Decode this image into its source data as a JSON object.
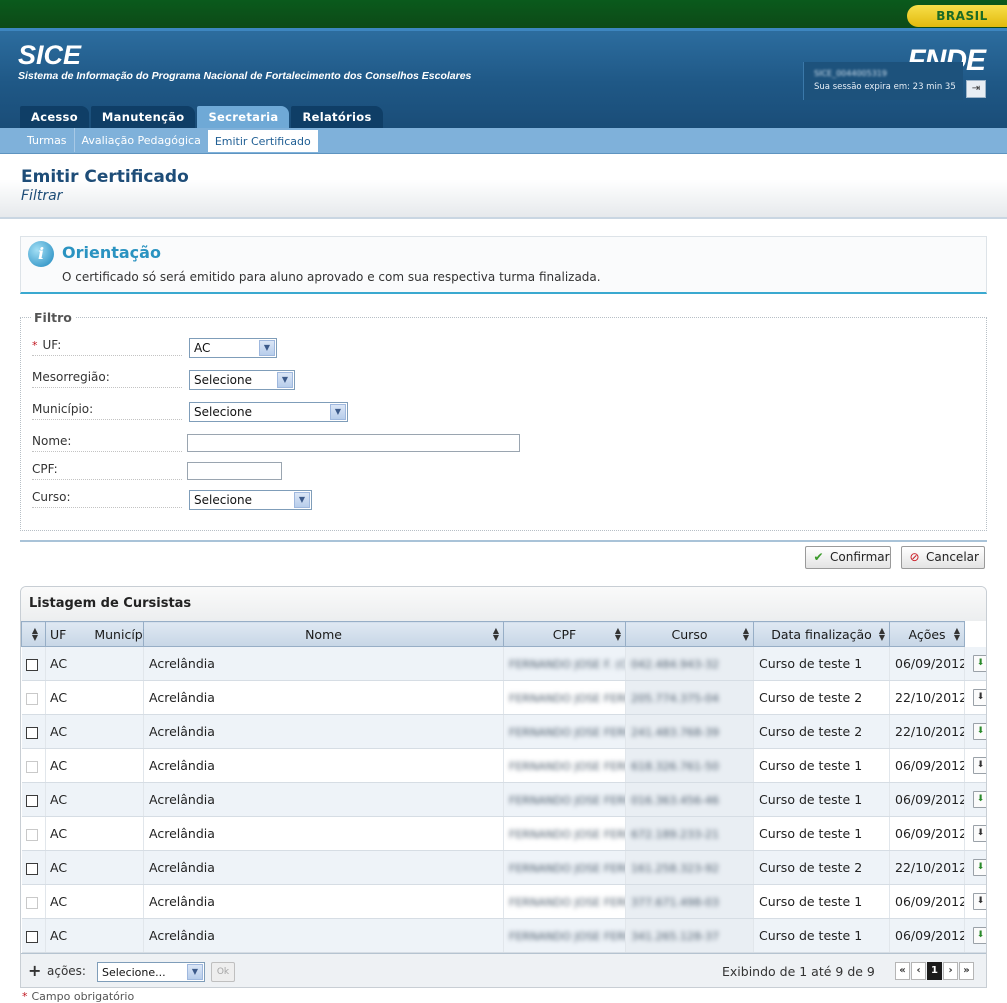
{
  "govbar": {
    "brasil": "BRASIL"
  },
  "header": {
    "title": "SICE",
    "subtitle": "Sistema de Informação do Programa Nacional de Fortalecimento dos Conselhos Escolares",
    "logo": "FNDE",
    "session_user": "SICE_0044005319",
    "session_expire": "Sua sessão expira em: 23 min 35"
  },
  "tabs": [
    {
      "label": "Acesso"
    },
    {
      "label": "Manutenção"
    },
    {
      "label": "Secretaria"
    },
    {
      "label": "Relatórios"
    }
  ],
  "subtabs": [
    {
      "label": "Turmas"
    },
    {
      "label": "Avaliação Pedagógica"
    },
    {
      "label": "Emitir Certificado"
    }
  ],
  "page": {
    "title": "Emitir Certificado",
    "subtitle": "Filtrar"
  },
  "orientation": {
    "title": "Orientação",
    "text": "O certificado só será emitido para aluno aprovado e com sua respectiva turma finalizada."
  },
  "filter": {
    "legend": "Filtro",
    "uf_label": "UF:",
    "uf_value": "AC",
    "mesorregiao_label": "Mesorregião:",
    "mesorregiao_value": "Selecione",
    "municipio_label": "Município:",
    "municipio_value": "Selecione",
    "nome_label": "Nome:",
    "nome_value": "",
    "cpf_label": "CPF:",
    "cpf_value": "",
    "curso_label": "Curso:",
    "curso_value": "Selecione"
  },
  "buttons": {
    "confirm": "Confirmar",
    "cancel": "Cancelar"
  },
  "listing": {
    "title": "Listagem de Cursistas",
    "columns": [
      "UF",
      "Município",
      "Nome",
      "CPF",
      "Curso",
      "Data finalização",
      "Ações"
    ],
    "rows": [
      {
        "uf": "AC",
        "municipio": "Acrelândia",
        "nome": "FERNANDO JOSE F. (CURSO AVALIADO)",
        "cpf": "042.484.943-32",
        "curso": "Curso de teste 1",
        "data": "06/09/2012"
      },
      {
        "uf": "AC",
        "municipio": "Acrelândia",
        "nome": "FERNANDO JOSE FERRARA",
        "cpf": "205.774.375-04",
        "curso": "Curso de teste 2",
        "data": "22/10/2012"
      },
      {
        "uf": "AC",
        "municipio": "Acrelândia",
        "nome": "FERNANDO JOSE FERRARA",
        "cpf": "241.483.768-39",
        "curso": "Curso de teste 2",
        "data": "22/10/2012"
      },
      {
        "uf": "AC",
        "municipio": "Acrelândia",
        "nome": "FERNANDO JOSE FERRARA",
        "cpf": "618.326.761-50",
        "curso": "Curso de teste 1",
        "data": "06/09/2012"
      },
      {
        "uf": "AC",
        "municipio": "Acrelândia",
        "nome": "FERNANDO JOSE FERRARA",
        "cpf": "016.363.456-46",
        "curso": "Curso de teste 1",
        "data": "06/09/2012"
      },
      {
        "uf": "AC",
        "municipio": "Acrelândia",
        "nome": "FERNANDO JOSE FERRARA",
        "cpf": "672.189.233-21",
        "curso": "Curso de teste 1",
        "data": "06/09/2012"
      },
      {
        "uf": "AC",
        "municipio": "Acrelândia",
        "nome": "FERNANDO JOSE FERRARA",
        "cpf": "161.258.323-92",
        "curso": "Curso de teste 2",
        "data": "22/10/2012"
      },
      {
        "uf": "AC",
        "municipio": "Acrelândia",
        "nome": "FERNANDO JOSE FERRARA",
        "cpf": "377.671.498-03",
        "curso": "Curso de teste 1",
        "data": "06/09/2012"
      },
      {
        "uf": "AC",
        "municipio": "Acrelândia",
        "nome": "FERNANDO JOSE FERRARA (FINALIZADA E ATIVA)",
        "cpf": "341.265.128-37",
        "curso": "Curso de teste 1",
        "data": "06/09/2012"
      }
    ],
    "footer_acoes": "ações:",
    "footer_select": "Selecione...",
    "footer_ok": "Ok",
    "showing": "Exibindo de 1 até 9 de 9",
    "page_current": "1"
  },
  "required_note": "Campo obrigatório"
}
